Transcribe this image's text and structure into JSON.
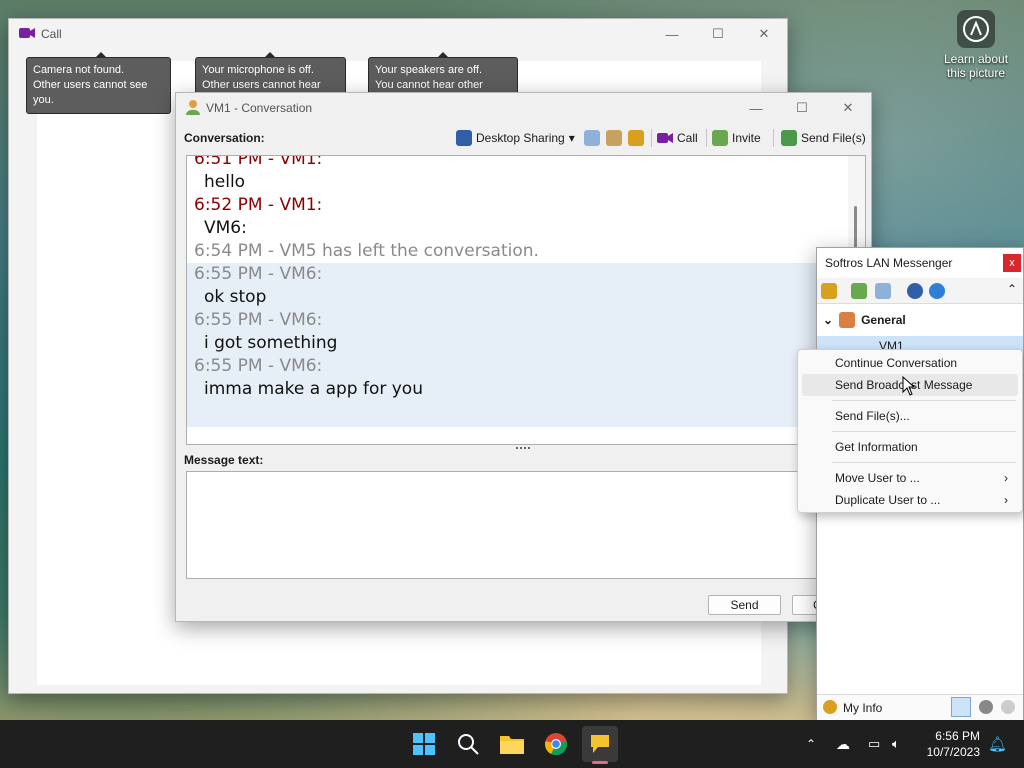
{
  "call_window": {
    "title": "Call",
    "tooltips": [
      {
        "line1": "Camera not found.",
        "line2": "Other users cannot see you."
      },
      {
        "line1": "Your microphone is off.",
        "line2": "Other users cannot hear you."
      },
      {
        "line1": "Your speakers are off.",
        "line2": "You cannot hear other users."
      }
    ]
  },
  "conversation": {
    "title": "VM1 - Conversation",
    "label": "Conversation:",
    "toolbar": {
      "desktop_sharing": "Desktop Sharing",
      "call": "Call",
      "invite": "Invite",
      "send_files": "Send File(s)"
    },
    "messages": [
      {
        "header": "6:51 PM - VM1:",
        "body": "hello",
        "style": "red"
      },
      {
        "header": "6:52 PM - VM1:",
        "body": "VM6:",
        "style": "red"
      },
      {
        "header": "6:54 PM - VM5 has left the conversation.",
        "body": "",
        "style": "grey"
      },
      {
        "header": "6:55 PM - VM6:",
        "body": "ok stop",
        "style": "grey"
      },
      {
        "header": "6:55 PM - VM6:",
        "body": "i got something",
        "style": "grey"
      },
      {
        "header": "6:55 PM - VM6:",
        "body": "imma make a app for you",
        "style": "grey"
      }
    ],
    "message_label": "Message text:",
    "message_value": "",
    "send_label": "Send",
    "close_label": "C"
  },
  "lan_messenger": {
    "title": "Softros LAN Messenger",
    "close": "x",
    "group": "General",
    "user": "VM1",
    "my_info": "My Info"
  },
  "context_menu": {
    "items": [
      "Continue Conversation",
      "Send Broadcast Message",
      "Send File(s)...",
      "Get Information",
      "Move User to ...",
      "Duplicate User to ..."
    ]
  },
  "desktop": {
    "learn_line1": "Learn about",
    "learn_line2": "this picture"
  },
  "taskbar": {
    "time": "6:56 PM",
    "date": "10/7/2023"
  },
  "colors": {
    "accent": "#0067c0",
    "message_header_red": "#8b0000",
    "message_header_grey": "#8a8a8a",
    "highlight": "#e6eef8"
  }
}
